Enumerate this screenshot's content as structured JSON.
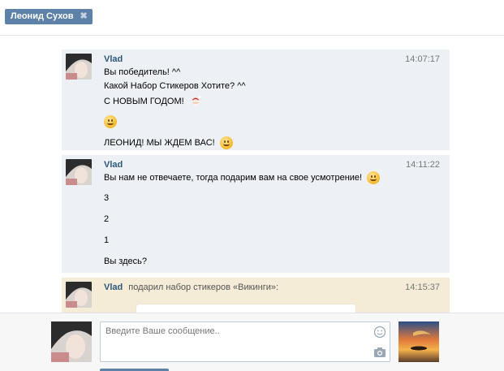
{
  "tab": {
    "title": "Леонид Сухов",
    "close_icon": "close-icon"
  },
  "messages": [
    {
      "author": "Vlad",
      "time": "14:07:17",
      "lines": [
        "Вы победитель! ^^",
        "Какой Набор Стикеров Хотите? ^^",
        "С НОВЫМ ГОДОМ!",
        "",
        "ЛЕОНИД! МЫ ЖДЕМ ВАС!"
      ]
    },
    {
      "author": "Vlad",
      "time": "14:11:22",
      "lines": [
        "Вы нам не отвечаете, тогда подарим вам на свое усмотрение!",
        "3",
        "2",
        "1",
        "Вы здесь?"
      ]
    },
    {
      "author": "Vlad",
      "action": "подарил набор стикеров «Викинги»:",
      "time": "14:15:37"
    }
  ],
  "composer": {
    "placeholder": "Введите Ваше сообщение..",
    "emoji_icon": "smiley-icon",
    "attach_icon": "camera-icon"
  },
  "colors": {
    "accent": "#5e81a8",
    "author": "#2b587a",
    "message_bg": "#edf0f5",
    "gift_bg": "#f4ecd7"
  }
}
